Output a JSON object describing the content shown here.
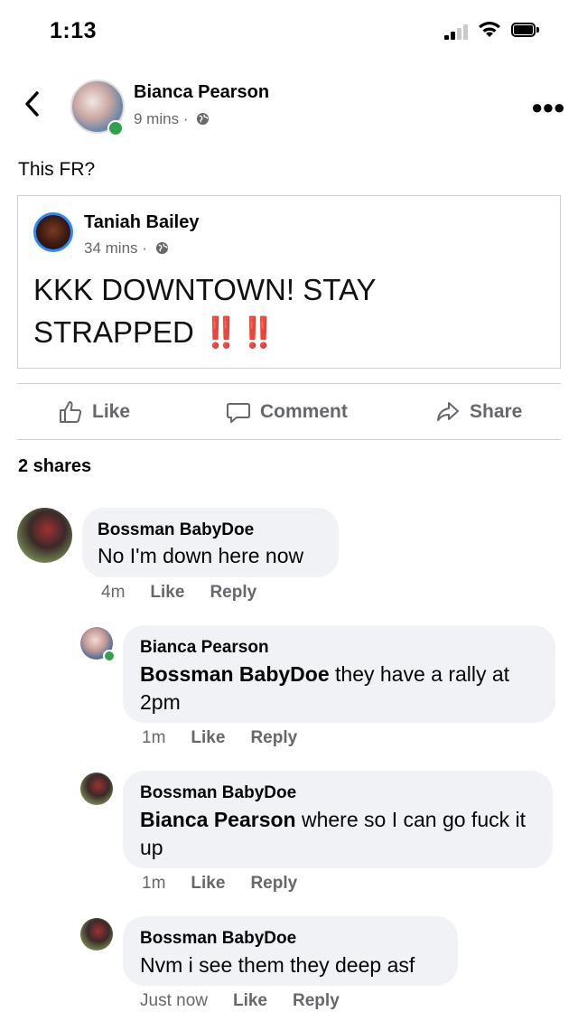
{
  "status_bar": {
    "time": "1:13"
  },
  "post": {
    "author": "Bianca Pearson",
    "time": "9 mins",
    "separator": "·",
    "text": "This FR?",
    "shared": {
      "author": "Taniah Bailey",
      "time": "34 mins",
      "separator": "·",
      "text": "KKK DOWNTOWN! STAY STRAPPED",
      "emphasis": "‼️‼️"
    }
  },
  "actions": {
    "like": "Like",
    "comment": "Comment",
    "share": "Share"
  },
  "shares_count": "2 shares",
  "comments": [
    {
      "name": "Bossman BabyDoe",
      "text": "No I'm down here now",
      "time": "4m",
      "like": "Like",
      "reply": "Reply"
    },
    {
      "name": "Bianca Pearson",
      "mention": "Bossman BabyDoe",
      "text": " they have a rally at 2pm",
      "time": "1m",
      "like": "Like",
      "reply": "Reply"
    },
    {
      "name": "Bossman BabyDoe",
      "mention": "Bianca Pearson",
      "text": " where so I can go fuck it up",
      "time": "1m",
      "like": "Like",
      "reply": "Reply"
    },
    {
      "name": "Bossman BabyDoe",
      "text": "Nvm i see them they deep asf",
      "time": "Just now",
      "like": "Like",
      "reply": "Reply"
    }
  ],
  "icons": {
    "back": "chevron-left-icon",
    "more": "more-dots-icon",
    "globe": "globe-icon",
    "like": "thumbs-up-icon",
    "comment": "comment-bubble-icon",
    "share": "share-arrow-icon",
    "signal": "cellular-signal-icon",
    "wifi": "wifi-icon",
    "battery": "battery-icon"
  },
  "colors": {
    "online": "#31a24c",
    "shared_ring": "#2d88ff",
    "secondary_text": "#65676b",
    "bubble": "#f0f2f5",
    "emphasis": "#e02020"
  }
}
